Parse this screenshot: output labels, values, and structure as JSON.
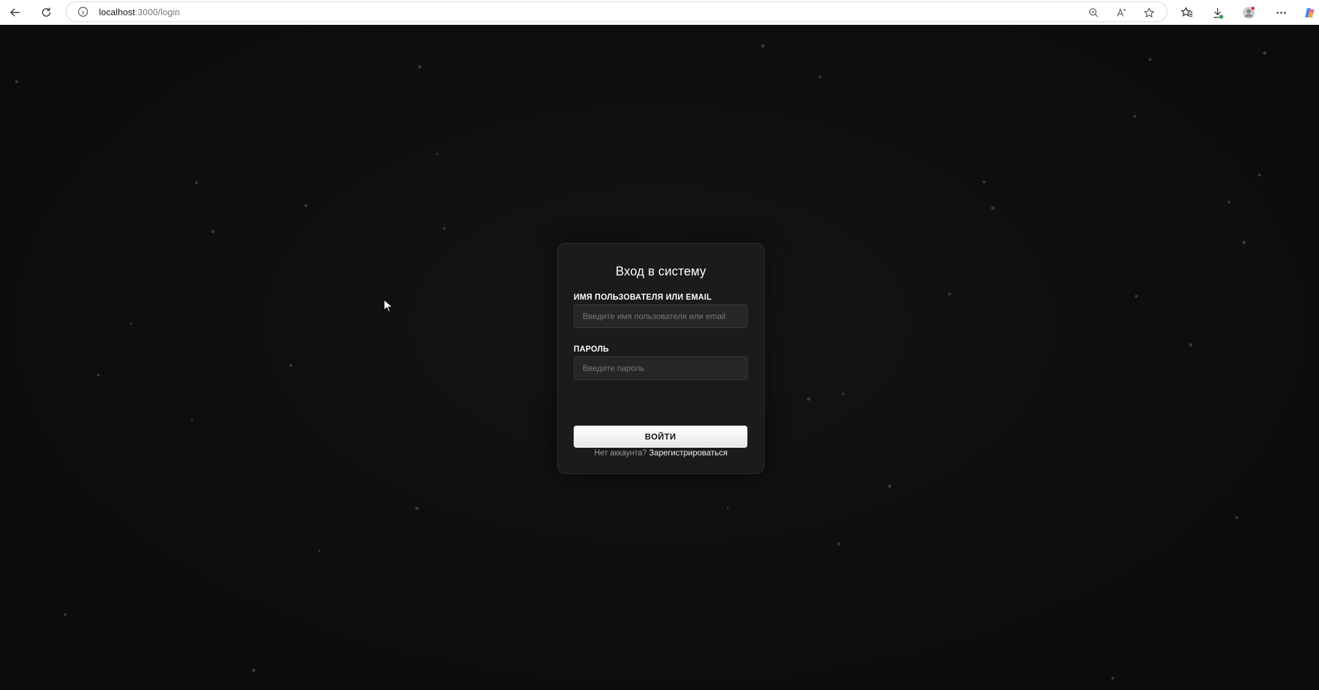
{
  "browser": {
    "url_host": "localhost",
    "url_path": ":3000/login",
    "icons": {
      "back": "arrow-left-icon",
      "refresh": "refresh-icon",
      "site_info": "info-icon",
      "zoom": "zoom-out-icon",
      "read_aloud": "read-aloud-icon",
      "favorite": "star-icon",
      "favorites_list": "favorites-icon",
      "downloads": "download-icon",
      "profile": "avatar-icon",
      "menu": "more-icon",
      "copilot": "copilot-icon"
    }
  },
  "login": {
    "title": "Вход в систему",
    "username_label": "ИМЯ ПОЛЬЗОВАТЕЛЯ ИЛИ EMAIL",
    "username_placeholder": "Введите имя пользователя или email",
    "username_value": "",
    "password_label": "ПАРОЛЬ",
    "password_placeholder": "Введите пароль",
    "password_value": "",
    "submit_label": "ВОЙТИ",
    "no_account_text": "Нет аккаунта?",
    "register_link": "Зарегистрироваться"
  },
  "colors": {
    "background": "#0d0d0d",
    "card": "#1b1b1b",
    "button": "#ffffff",
    "text": "#ffffff"
  }
}
